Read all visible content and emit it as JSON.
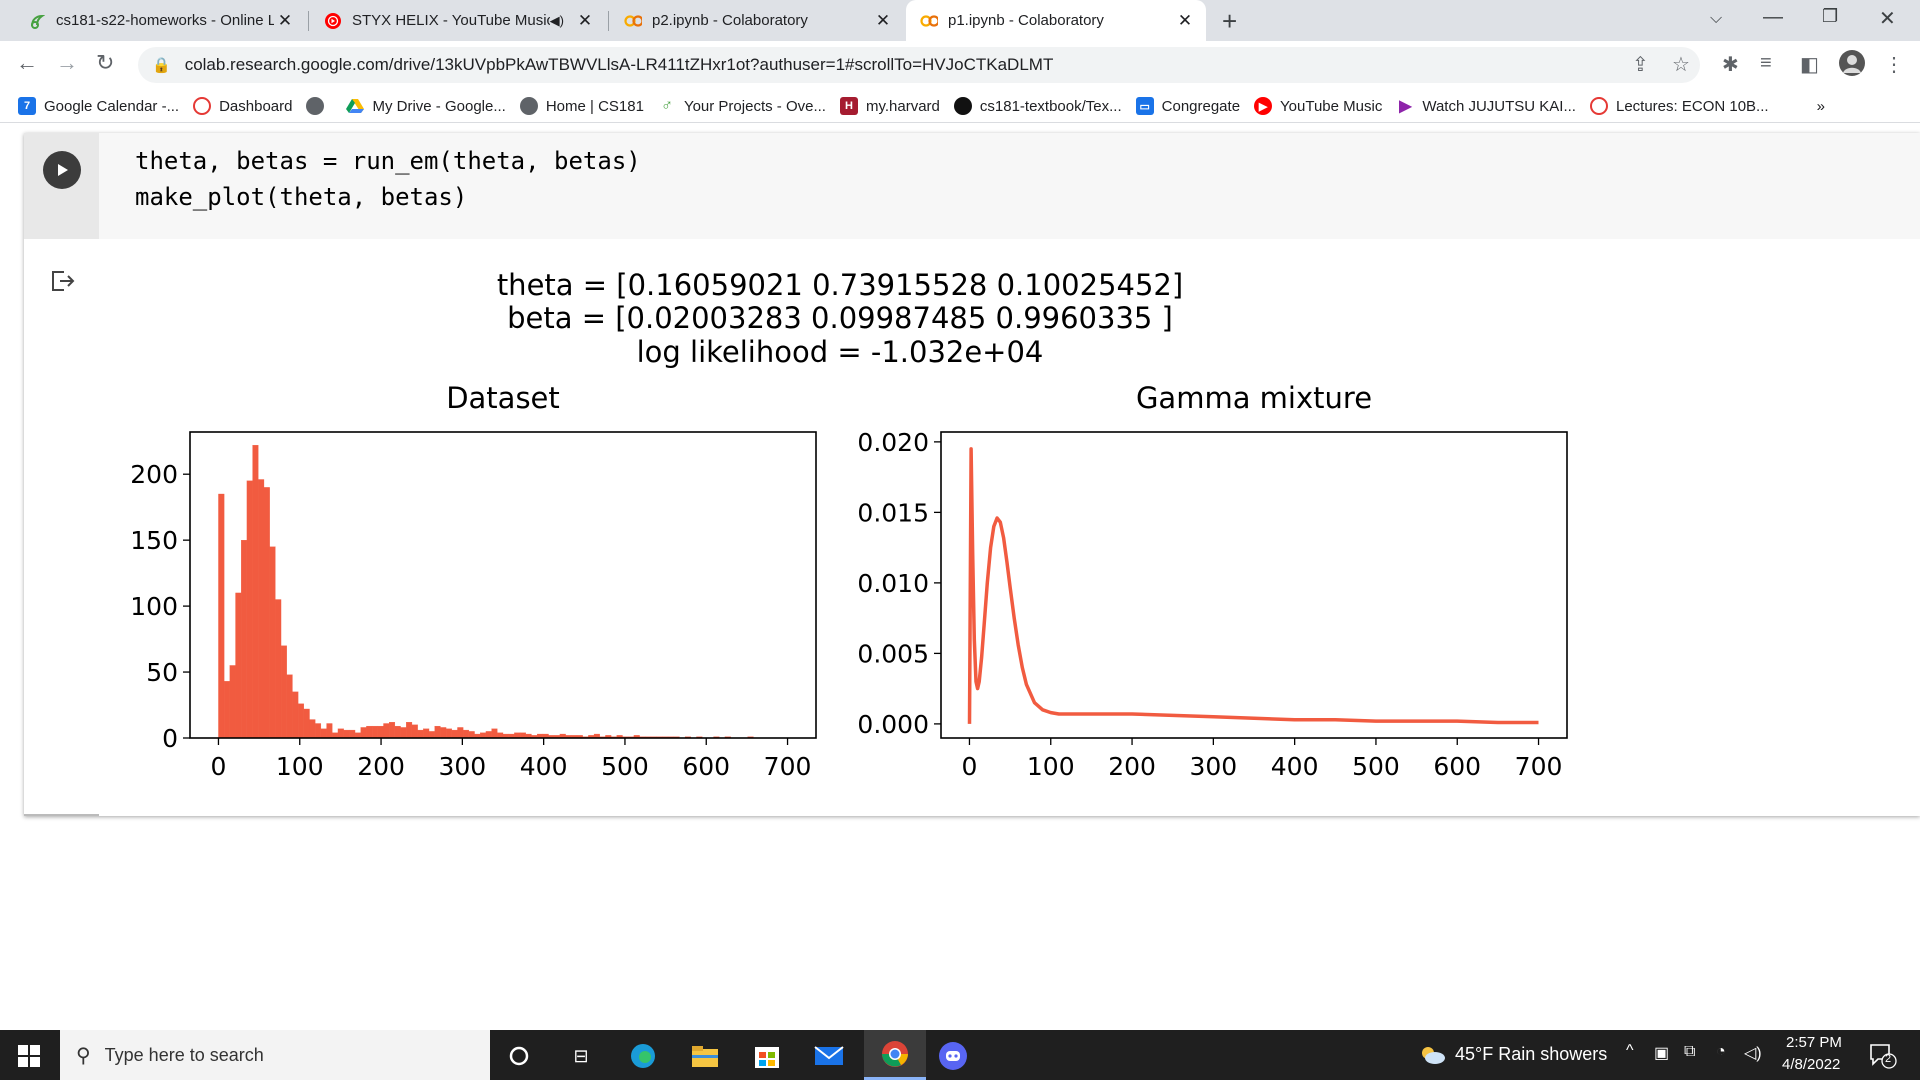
{
  "browser": {
    "tabs": [
      {
        "title": "cs181-s22-homeworks - Online L",
        "icon": "overleaf-icon"
      },
      {
        "title": "STYX HELIX - YouTube Music",
        "icon": "youtube-music-icon"
      },
      {
        "title": "p2.ipynb - Colaboratory",
        "icon": "colab-icon"
      },
      {
        "title": "p1.ipynb - Colaboratory",
        "icon": "colab-icon"
      }
    ],
    "url": "colab.research.google.com/drive/13kUVpbPkAwTBWVLlsA-LR411tZHxr1ot?authuser=1#scrollTo=HVJoCTKaDLMT",
    "bookmarks": [
      "Google Calendar -...",
      "Dashboard",
      "",
      "My Drive - Google...",
      "Home | CS181",
      "Your Projects - Ove...",
      "my.harvard",
      "cs181-textbook/Tex...",
      "Congregate",
      "YouTube Music",
      "Watch JUJUTSU KAI...",
      "Lectures: ECON 10B..."
    ],
    "bookmarks_more": "»"
  },
  "code": {
    "line1": "theta, betas = run_em(theta, betas)",
    "line2": "make_plot(theta, betas)"
  },
  "output": {
    "suptitle_line1": "theta = [0.16059021 0.73915528 0.10025452]",
    "suptitle_line2": "beta = [0.02003283 0.09987485 0.9960335 ]",
    "suptitle_line3": "log likelihood = -1.032e+04"
  },
  "chart_data": [
    {
      "type": "bar",
      "title": "Dataset",
      "xlabel": "",
      "ylabel": "",
      "xlim": [
        -35,
        735
      ],
      "ylim": [
        0,
        232
      ],
      "xticks": [
        0,
        100,
        200,
        300,
        400,
        500,
        600,
        700
      ],
      "yticks": [
        0,
        50,
        100,
        150,
        200
      ],
      "bin_width": 7,
      "bin_starts": [
        0,
        7,
        14,
        21,
        28,
        35,
        42,
        49,
        56,
        63,
        70,
        77,
        84,
        91,
        98,
        105,
        112,
        119,
        126,
        133,
        140,
        147,
        154,
        161,
        168,
        175,
        182,
        189,
        196,
        203,
        210,
        217,
        224,
        231,
        238,
        245,
        252,
        259,
        266,
        273,
        280,
        287,
        294,
        301,
        308,
        315,
        322,
        329,
        336,
        343,
        350,
        357,
        364,
        371,
        378,
        385,
        392,
        399,
        406,
        413,
        420,
        427,
        434,
        441,
        448,
        455,
        462,
        469,
        476,
        483,
        490,
        497,
        504,
        511,
        518,
        525,
        532,
        539,
        546,
        553,
        560,
        567,
        574,
        581,
        588,
        595,
        602,
        609,
        616,
        623,
        630,
        637,
        644,
        651,
        658,
        665,
        672,
        679,
        686,
        693
      ],
      "values": [
        185,
        43,
        55,
        110,
        150,
        195,
        222,
        196,
        190,
        145,
        105,
        70,
        48,
        35,
        26,
        22,
        14,
        11,
        7,
        11,
        4,
        7,
        6,
        6,
        4,
        8,
        9,
        9,
        9,
        11,
        12,
        9,
        8,
        12,
        10,
        6,
        7,
        5,
        9,
        8,
        7,
        6,
        8,
        6,
        5,
        3,
        4,
        5,
        7,
        4,
        3,
        3,
        4,
        4,
        3,
        2,
        3,
        3,
        2,
        2,
        3,
        2,
        2,
        2,
        1,
        2,
        3,
        1,
        2,
        1,
        2,
        1,
        1,
        2,
        1,
        1,
        1,
        1,
        1,
        1,
        1,
        0,
        1,
        0,
        1,
        0,
        0,
        1,
        0,
        1,
        0,
        0,
        0,
        1,
        0,
        0,
        0,
        0,
        0,
        0
      ],
      "color": "#f15b40"
    },
    {
      "type": "line",
      "title": "Gamma mixture",
      "xlabel": "",
      "ylabel": "",
      "xlim": [
        -35,
        735
      ],
      "ylim": [
        -0.001,
        0.0207
      ],
      "xticks": [
        0,
        100,
        200,
        300,
        400,
        500,
        600,
        700
      ],
      "yticks": [
        0.0,
        0.005,
        0.01,
        0.015,
        0.02
      ],
      "ytick_labels": [
        "0.000",
        "0.005",
        "0.010",
        "0.015",
        "0.020"
      ],
      "x": [
        0,
        2,
        4,
        6,
        8,
        10,
        12,
        15,
        18,
        22,
        26,
        30,
        34,
        38,
        42,
        46,
        50,
        55,
        60,
        65,
        70,
        80,
        90,
        100,
        110,
        120,
        140,
        160,
        180,
        200,
        250,
        300,
        350,
        400,
        450,
        500,
        550,
        600,
        650,
        700
      ],
      "y": [
        0.0,
        0.0195,
        0.012,
        0.006,
        0.003,
        0.0025,
        0.003,
        0.0047,
        0.007,
        0.01,
        0.0125,
        0.014,
        0.0146,
        0.0143,
        0.0132,
        0.0115,
        0.0097,
        0.0075,
        0.0056,
        0.004,
        0.0028,
        0.0015,
        0.001,
        0.0008,
        0.0007,
        0.0007,
        0.0007,
        0.0007,
        0.0007,
        0.0007,
        0.0006,
        0.0005,
        0.0004,
        0.0003,
        0.0003,
        0.0002,
        0.0002,
        0.0002,
        0.0001,
        0.0001
      ],
      "color": "#f15b40"
    }
  ],
  "taskbar": {
    "search_placeholder": "Type here to search",
    "weather": "45°F  Rain showers",
    "time": "2:57 PM",
    "date": "4/8/2022",
    "notification_count": "2"
  }
}
